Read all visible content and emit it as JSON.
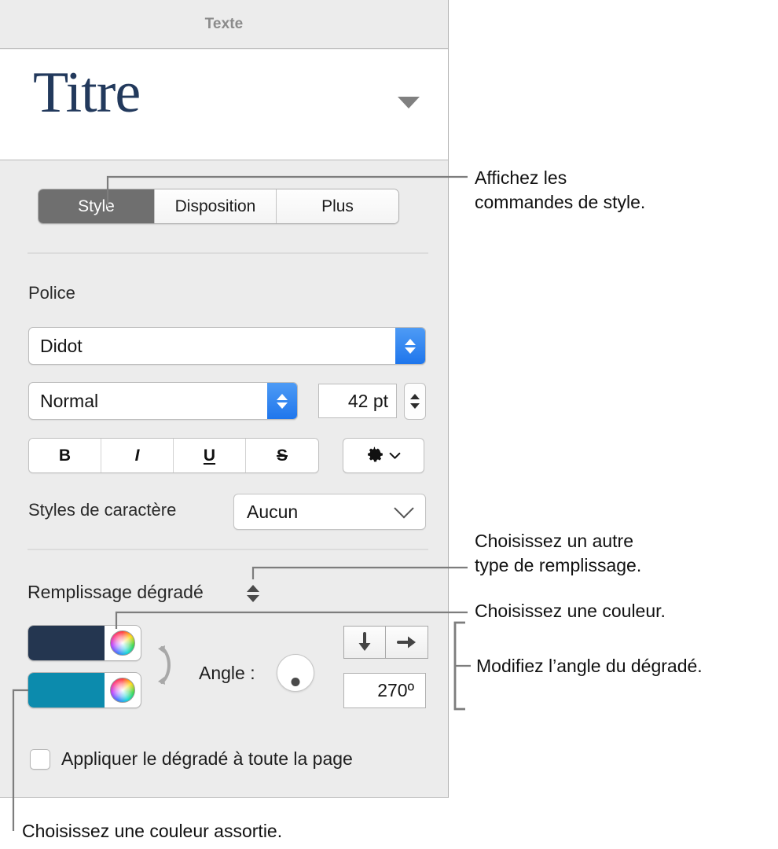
{
  "panel": {
    "titlebar": {
      "title": "Texte"
    },
    "style_preview": {
      "style_name": "Titre",
      "caret_icon": "triangle-down-icon"
    },
    "segmented_tabs": [
      {
        "label": "Style",
        "active": true
      },
      {
        "label": "Disposition",
        "active": false
      },
      {
        "label": "Plus",
        "active": false
      }
    ],
    "font_section": {
      "label": "Police",
      "family_value": "Didot",
      "weight_value": "Normal",
      "size_value": "42 pt",
      "family_stepper_icon": "stepper-updown-icon",
      "weight_stepper_icon": "stepper-updown-icon",
      "size_stepper_icon": "stepper-updown-icon"
    },
    "text_format_buttons": [
      {
        "label": "B",
        "name": "bold-button"
      },
      {
        "label": "I",
        "name": "italic-button"
      },
      {
        "label": "U",
        "name": "underline-button"
      },
      {
        "label": "S",
        "name": "strikethrough-button"
      }
    ],
    "gear_button": {
      "icon": "gear-icon",
      "chevron": "chevron-down-icon"
    },
    "character_styles": {
      "label": "Styles de caractère",
      "value": "Aucun",
      "chevron_icon": "chevron-down-icon"
    },
    "fill_section": {
      "label": "Remplissage dégradé",
      "stepper_icon": "stepper-updown-icon",
      "color_top": "#243650",
      "color_bottom": "#0c8bad",
      "color_wheel_icon": "color-wheel-icon",
      "swap_icon": "swap-arrows-icon",
      "angle_label": "Angle :",
      "angle_dial_icon": "angle-dial-icon",
      "direction_buttons": [
        {
          "icon": "arrow-down-icon",
          "name": "gradient-direction-down-button"
        },
        {
          "icon": "arrow-right-icon",
          "name": "gradient-direction-right-button"
        }
      ],
      "angle_value": "270º"
    },
    "apply_page": {
      "checked": false,
      "label": "Appliquer le dégradé à toute la page"
    }
  },
  "callouts": [
    {
      "id": "co1",
      "text": "Affichez les\ncommandes de style."
    },
    {
      "id": "co2",
      "text": "Choisissez un autre\ntype de remplissage."
    },
    {
      "id": "co3",
      "text": "Choisissez une couleur."
    },
    {
      "id": "co4",
      "text": "Modifiez l’angle du dégradé."
    },
    {
      "id": "co5",
      "text": "Choisissez une couleur assortie."
    }
  ],
  "colors": {
    "panel_background": "#ececec",
    "preview_background": "#ffffff",
    "accent_blue": "#2079ef",
    "active_tab": "#6f6f6f",
    "style_name_color": "#22395c",
    "callout_line": "#7d7d7d"
  }
}
